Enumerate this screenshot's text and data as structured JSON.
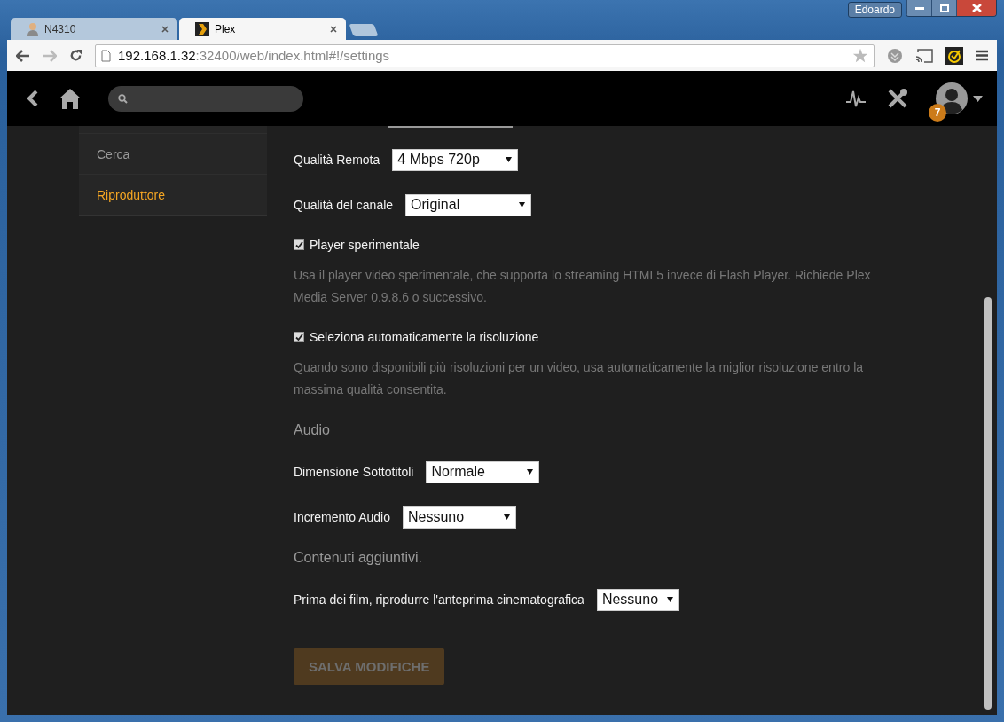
{
  "window": {
    "user": "Edoardo"
  },
  "tabs": [
    {
      "title": "N4310",
      "selected": false
    },
    {
      "title": "Plex",
      "selected": true
    }
  ],
  "address": {
    "host": "192.168.1.32",
    "path": ":32400/web/index.html#!/settings"
  },
  "header": {
    "notifications": "7"
  },
  "sidebar": {
    "items": [
      {
        "label": "Cerca",
        "selected": false
      },
      {
        "label": "Riproduttore",
        "selected": true
      }
    ]
  },
  "settings": [
    {
      "kind": "select",
      "label": "Qualità Remota",
      "value": "4 Mbps 720p"
    },
    {
      "kind": "select",
      "label": "Qualità del canale",
      "value": "Original"
    },
    {
      "kind": "checkbox",
      "label": "Player sperimentale",
      "checked": true,
      "description": "Usa il player video sperimentale, che supporta lo streaming HTML5 invece di Flash Player. Richiede Plex Media Server 0.9.8.6 o successivo."
    },
    {
      "kind": "checkbox",
      "label": "Seleziona automaticamente la risoluzione",
      "checked": true,
      "description": "Quando sono disponibili più risoluzioni per un video, usa automaticamente la miglior risoluzione entro la massima qualità consentita."
    },
    {
      "kind": "heading",
      "label": "Audio"
    },
    {
      "kind": "select",
      "label": "Dimensione Sottotitoli",
      "value": "Normale"
    },
    {
      "kind": "select",
      "label": "Incremento Audio",
      "value": "Nessuno"
    },
    {
      "kind": "heading",
      "label": "Contenuti aggiuntivi."
    },
    {
      "kind": "select",
      "label": "Prima dei film, riprodurre l'anteprima cinematografica",
      "value": "Nessuno"
    }
  ],
  "save_button": {
    "label": "SALVA MODIFICHE",
    "disabled": true
  }
}
